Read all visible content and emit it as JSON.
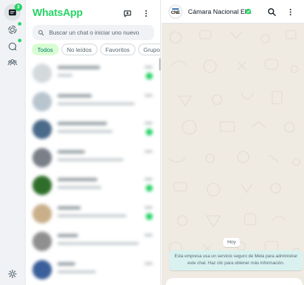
{
  "rail": {
    "chats_badge": "3",
    "items": [
      {
        "name": "chats-icon",
        "active": true
      },
      {
        "name": "status-icon",
        "dot": true
      },
      {
        "name": "channels-icon",
        "dot": true
      },
      {
        "name": "communities-icon"
      }
    ],
    "settings_icon": "gear-icon"
  },
  "sidebar": {
    "title": "WhatsApp",
    "new_chat_icon": "new-chat-icon",
    "menu_icon": "vertical-dots-icon",
    "search": {
      "placeholder": "Buscar un chat o iniciar uno nuevo"
    },
    "filters": [
      {
        "label": "Todos",
        "active": true
      },
      {
        "label": "No leídos"
      },
      {
        "label": "Favoritos"
      },
      {
        "label": "Grupos"
      }
    ],
    "chats": [
      {
        "avatar_color": "#d4d9dc",
        "unread": true
      },
      {
        "avatar_color": "#b8c5cf",
        "unread": false
      },
      {
        "avatar_color": "#4a6a8a",
        "unread": true
      },
      {
        "avatar_color": "#7a7f88",
        "unread": false
      },
      {
        "avatar_color": "#2f6e2a",
        "unread": true
      },
      {
        "avatar_color": "#c9b08a",
        "unread": true
      },
      {
        "avatar_color": "#8f8f8f",
        "unread": false
      },
      {
        "avatar_color": "#3a5f9a",
        "unread": false
      }
    ]
  },
  "conversation": {
    "title": "Cámara Nacional El...",
    "logo_text": "CNE",
    "verified_icon": "verified-check-icon",
    "search_icon": "search-icon",
    "menu_icon": "vertical-dots-icon",
    "date_label": "Hoy",
    "notice_line1": "Esta empresa usa un servicio seguro de Meta para administrar",
    "notice_line2": "este chat. Haz clic para obtener más información."
  },
  "colors": {
    "accent": "#25d366",
    "active_chip_bg": "#d9fdd3",
    "notice_bg": "#d9f2f0"
  }
}
